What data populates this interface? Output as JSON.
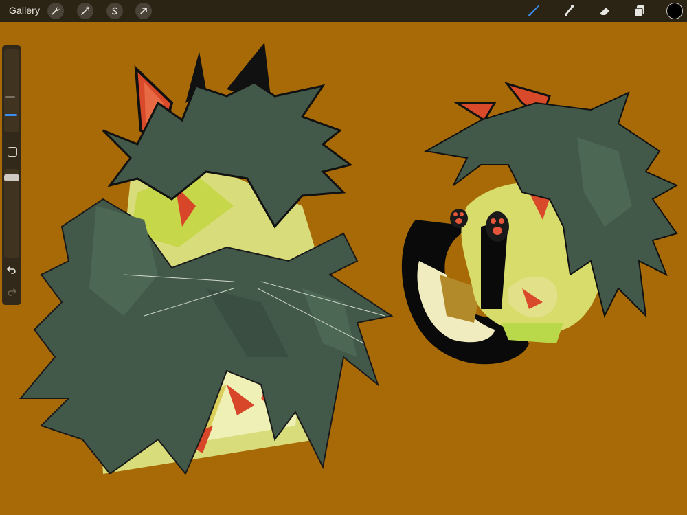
{
  "toolbar": {
    "gallery_label": "Gallery",
    "left_tools": [
      "wrench-icon",
      "magic-wand-icon",
      "selection-s-icon",
      "transform-arrow-icon"
    ],
    "right_tools": [
      "brush-icon",
      "smudge-icon",
      "eraser-icon",
      "layers-icon"
    ],
    "active_tool": "brush-icon",
    "current_color": "#000000"
  },
  "sidebar": {
    "brush_size_level": 0.15,
    "opacity_level": 0.35,
    "undo_icon": "undo-icon",
    "redo_icon": "redo-icon"
  },
  "canvas": {
    "background": "#a76a07"
  }
}
